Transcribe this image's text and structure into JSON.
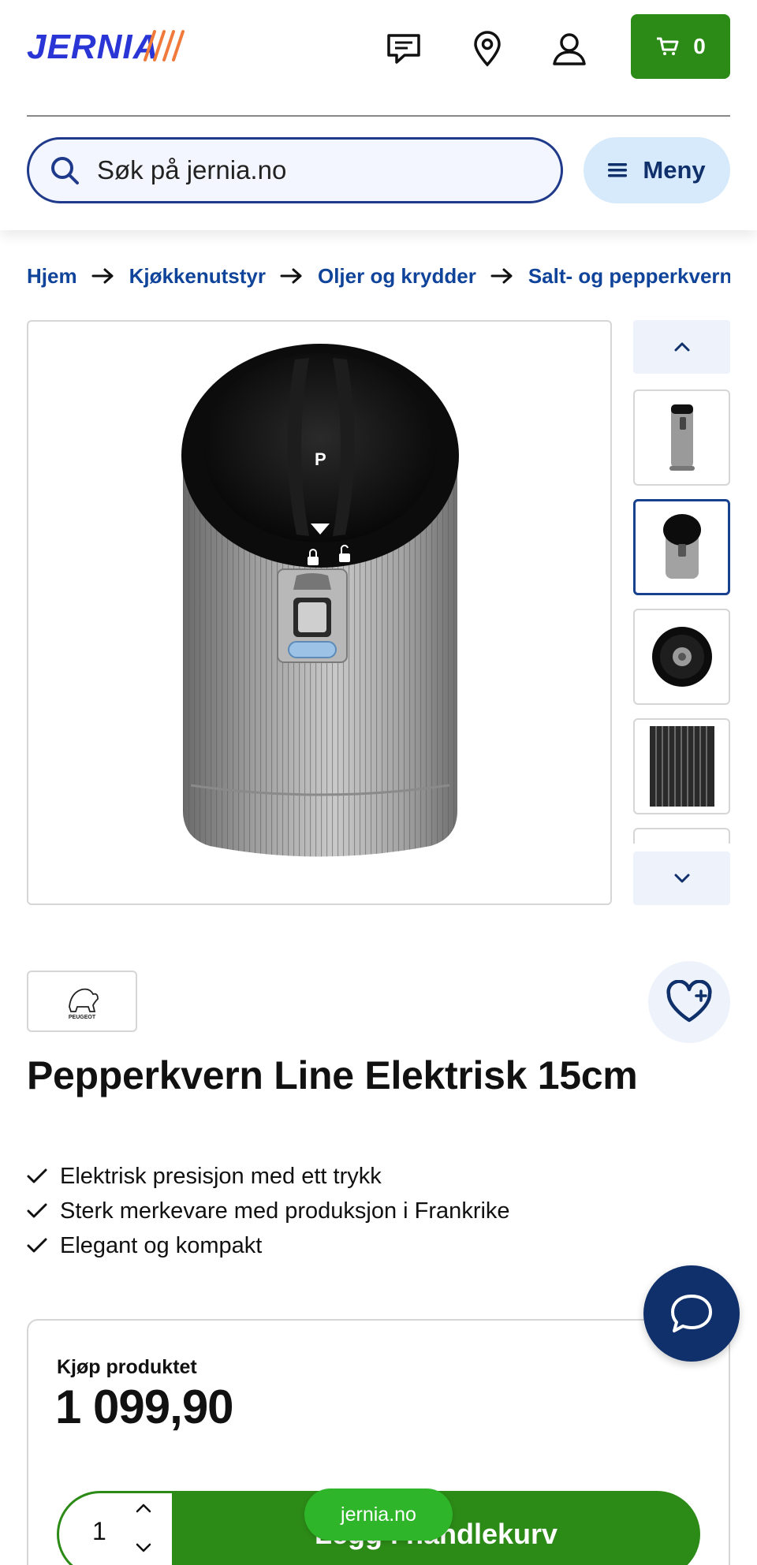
{
  "header": {
    "logo_text": "JERNIA",
    "icons": [
      "chat-icon",
      "location-icon",
      "user-icon"
    ],
    "cart": {
      "icon": "cart-icon",
      "count": "0"
    },
    "search": {
      "placeholder": "Søk på jernia.no",
      "icon": "search-icon"
    },
    "menu": {
      "label": "Meny",
      "icon": "hamburger-icon"
    }
  },
  "breadcrumb": [
    "Hjem",
    "Kjøkkenutstyr",
    "Oljer og krydder",
    "Salt- og pepperkverner"
  ],
  "gallery": {
    "thumbnails": 5,
    "active_index": 1
  },
  "product": {
    "brand": "PEUGEOT",
    "title": "Pepperkvern Line Elektrisk 15cm",
    "usps": [
      "Elektrisk presisjon med ett trykk",
      "Sterk merkevare med produksjon i Frankrike",
      "Elegant og kompakt"
    ],
    "grinder_mark": "P"
  },
  "buy": {
    "label": "Kjøp produktet",
    "price": "1 099,90",
    "quantity": "1",
    "add_to_cart": "Legg i handlekurv"
  },
  "toast": "jernia.no",
  "colors": {
    "brand_blue": "#1f3a8a",
    "green": "#2c8a17",
    "navy": "#10306b",
    "accent_orange": "#f07a3a"
  }
}
